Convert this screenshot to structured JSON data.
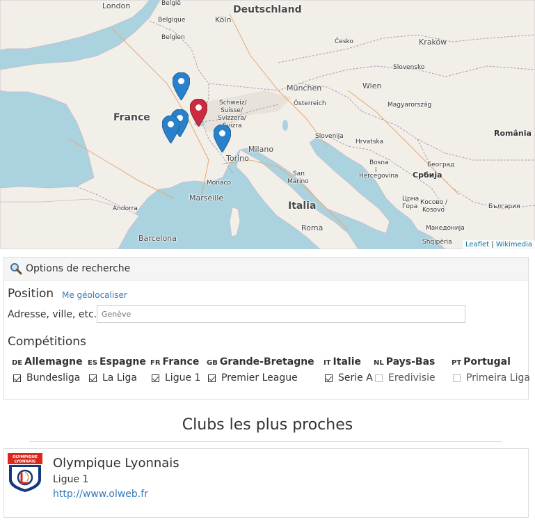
{
  "map": {
    "countries": [
      {
        "key": "belgie",
        "label": "België"
      },
      {
        "key": "belgique",
        "label": "Belgique"
      },
      {
        "key": "belgien",
        "label": "Belgien"
      },
      {
        "key": "deutschland",
        "label": "Deutschland"
      },
      {
        "key": "cesko",
        "label": "Česko"
      },
      {
        "key": "france",
        "label": "France"
      },
      {
        "key": "osterreich",
        "label": "Österreich"
      },
      {
        "key": "magyarorszag",
        "label": "Magyarország"
      },
      {
        "key": "slovensko",
        "label": "Slovensko"
      },
      {
        "key": "slovenija",
        "label": "Slovenija"
      },
      {
        "key": "hrvatska",
        "label": "Hrvatska"
      },
      {
        "key": "bosna",
        "label": "Bosna"
      },
      {
        "key": "i",
        "label": "i"
      },
      {
        "key": "hercegovina",
        "label": "Hercegovina"
      },
      {
        "key": "srbija",
        "label": "Србија"
      },
      {
        "key": "romania",
        "label": "România"
      },
      {
        "key": "italia",
        "label": "Italia"
      },
      {
        "key": "schweiz",
        "label": "Schweiz/"
      },
      {
        "key": "suisse",
        "label": "Suisse/"
      },
      {
        "key": "svizzera",
        "label": "Svizzera/"
      },
      {
        "key": "svizra",
        "label": "Svizra"
      },
      {
        "key": "bulgaria",
        "label": "България"
      },
      {
        "key": "kosovo1",
        "label": "Косово /"
      },
      {
        "key": "kosovo2",
        "label": "Kosovo"
      },
      {
        "key": "makedonija",
        "label": "Македонија"
      },
      {
        "key": "shqiperia",
        "label": "Shqipëria"
      },
      {
        "key": "crna",
        "label": "Црна"
      },
      {
        "key": "gora",
        "label": "Гора"
      }
    ],
    "cities": [
      {
        "key": "london",
        "label": "London"
      },
      {
        "key": "koln",
        "label": "Köln"
      },
      {
        "key": "krakow",
        "label": "Kraków"
      },
      {
        "key": "munchen",
        "label": "München"
      },
      {
        "key": "wien",
        "label": "Wien"
      },
      {
        "key": "milano",
        "label": "Milano"
      },
      {
        "key": "torino",
        "label": "Torino"
      },
      {
        "key": "monaco",
        "label": "Monaco"
      },
      {
        "key": "marseille",
        "label": "Marseille"
      },
      {
        "key": "andorra",
        "label": "Andorra"
      },
      {
        "key": "barcelona",
        "label": "Barcelona"
      },
      {
        "key": "sanmarino1",
        "label": "San"
      },
      {
        "key": "sanmarino2",
        "label": "Marino"
      },
      {
        "key": "roma",
        "label": "Roma"
      },
      {
        "key": "beograd",
        "label": "Београд"
      }
    ],
    "markers": [
      {
        "key": "m1",
        "color": "#2a81cb"
      },
      {
        "key": "m2",
        "color": "#2a81cb"
      },
      {
        "key": "m3",
        "color": "#2a81cb"
      },
      {
        "key": "m4",
        "color": "#cb2b3e"
      },
      {
        "key": "m5",
        "color": "#2a81cb"
      }
    ],
    "attribution": {
      "leaflet": "Leaflet",
      "sep": " | ",
      "wikimedia": "Wikimedia"
    }
  },
  "search": {
    "header_title": "Options de recherche",
    "header_icon": "search-icon",
    "position_title": "Position",
    "geolocate_link": "Me géolocaliser",
    "address_label": "Adresse, ville, etc.",
    "address_placeholder": "Genève",
    "competitions_title": "Compétitions",
    "competitions": [
      {
        "code": "DE",
        "country": "Allemagne",
        "league": "Bundesliga",
        "checked": true
      },
      {
        "code": "ES",
        "country": "Espagne",
        "league": "La Liga",
        "checked": true
      },
      {
        "code": "FR",
        "country": "France",
        "league": "Ligue 1",
        "checked": true
      },
      {
        "code": "GB",
        "country": "Grande-Bretagne",
        "league": "Premier League",
        "checked": true
      },
      {
        "code": "IT",
        "country": "Italie",
        "league": "Serie A",
        "checked": true
      },
      {
        "code": "NL",
        "country": "Pays-Bas",
        "league": "Eredivisie",
        "checked": false
      },
      {
        "code": "PT",
        "country": "Portugal",
        "league": "Primeira Liga",
        "checked": false
      }
    ]
  },
  "results": {
    "title": "Clubs les plus proches",
    "clubs": [
      {
        "name": "Olympique Lyonnais",
        "league": "Ligue 1",
        "url": "http://www.olweb.fr",
        "logo_text": "OLYMPIQUE LYONNAIS",
        "logo_colors": {
          "primary": "#da291c",
          "secondary": "#14387f"
        }
      }
    ]
  }
}
